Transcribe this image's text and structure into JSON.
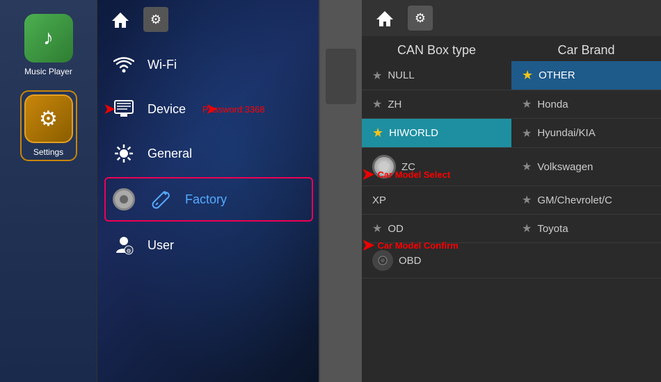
{
  "sidebar": {
    "apps": [
      {
        "id": "music-player",
        "label": "Music Player",
        "icon": "♪",
        "icon_style": "music"
      },
      {
        "id": "settings",
        "label": "Settings",
        "icon": "⚙",
        "icon_style": "settings",
        "active": true
      }
    ]
  },
  "settings_menu": {
    "top_bar": {
      "home_icon": "⌂",
      "gear_icon": "⚙"
    },
    "items": [
      {
        "id": "wifi",
        "label": "Wi-Fi",
        "icon": "wifi"
      },
      {
        "id": "device",
        "label": "Device",
        "icon": "device"
      },
      {
        "id": "general",
        "label": "General",
        "icon": "gear"
      },
      {
        "id": "factory",
        "label": "Factory",
        "icon": "wrench",
        "active": true
      },
      {
        "id": "user",
        "label": "User",
        "icon": "user"
      }
    ],
    "password_label": "Password:3368"
  },
  "can_panel": {
    "top_bar": {
      "home_icon": "⌂",
      "gear_icon": "⚙"
    },
    "headers": {
      "col1": "CAN Box type",
      "col2": "Car Brand"
    },
    "rows": [
      {
        "col1": {
          "label": "NULL",
          "star": "normal",
          "highlighted": false
        },
        "col2": {
          "label": "OTHER",
          "star": "yellow",
          "highlighted": true
        }
      },
      {
        "col1": {
          "label": "ZH",
          "star": "normal",
          "highlighted": false
        },
        "col2": {
          "label": "Honda",
          "star": "normal",
          "highlighted": false
        }
      },
      {
        "col1": {
          "label": "HIWORLD",
          "star": "yellow",
          "highlighted": true
        },
        "col2": {
          "label": "Hyundai/KIA",
          "star": "normal",
          "highlighted": false
        }
      },
      {
        "col1": {
          "label": "ZC",
          "star": "none",
          "highlighted": false,
          "toggle": true
        },
        "col2": {
          "label": "Volkswagen",
          "star": "normal",
          "highlighted": false
        }
      },
      {
        "col1": {
          "label": "XP",
          "star": "none",
          "highlighted": false
        },
        "col2": {
          "label": "GM/Chevrolet/C",
          "star": "normal",
          "highlighted": false
        }
      },
      {
        "col1": {
          "label": "OD",
          "star": "normal",
          "highlighted": false
        },
        "col2": {
          "label": "Toyota",
          "star": "normal",
          "highlighted": false
        }
      },
      {
        "col1": {
          "label": "OBD",
          "star": "none",
          "highlighted": false,
          "speaker": true
        },
        "col2": {
          "label": "",
          "star": "none",
          "highlighted": false
        }
      }
    ],
    "annotations": {
      "car_model_select": "Car Model Select",
      "car_model_confirm": "Car Model Confirm"
    }
  }
}
